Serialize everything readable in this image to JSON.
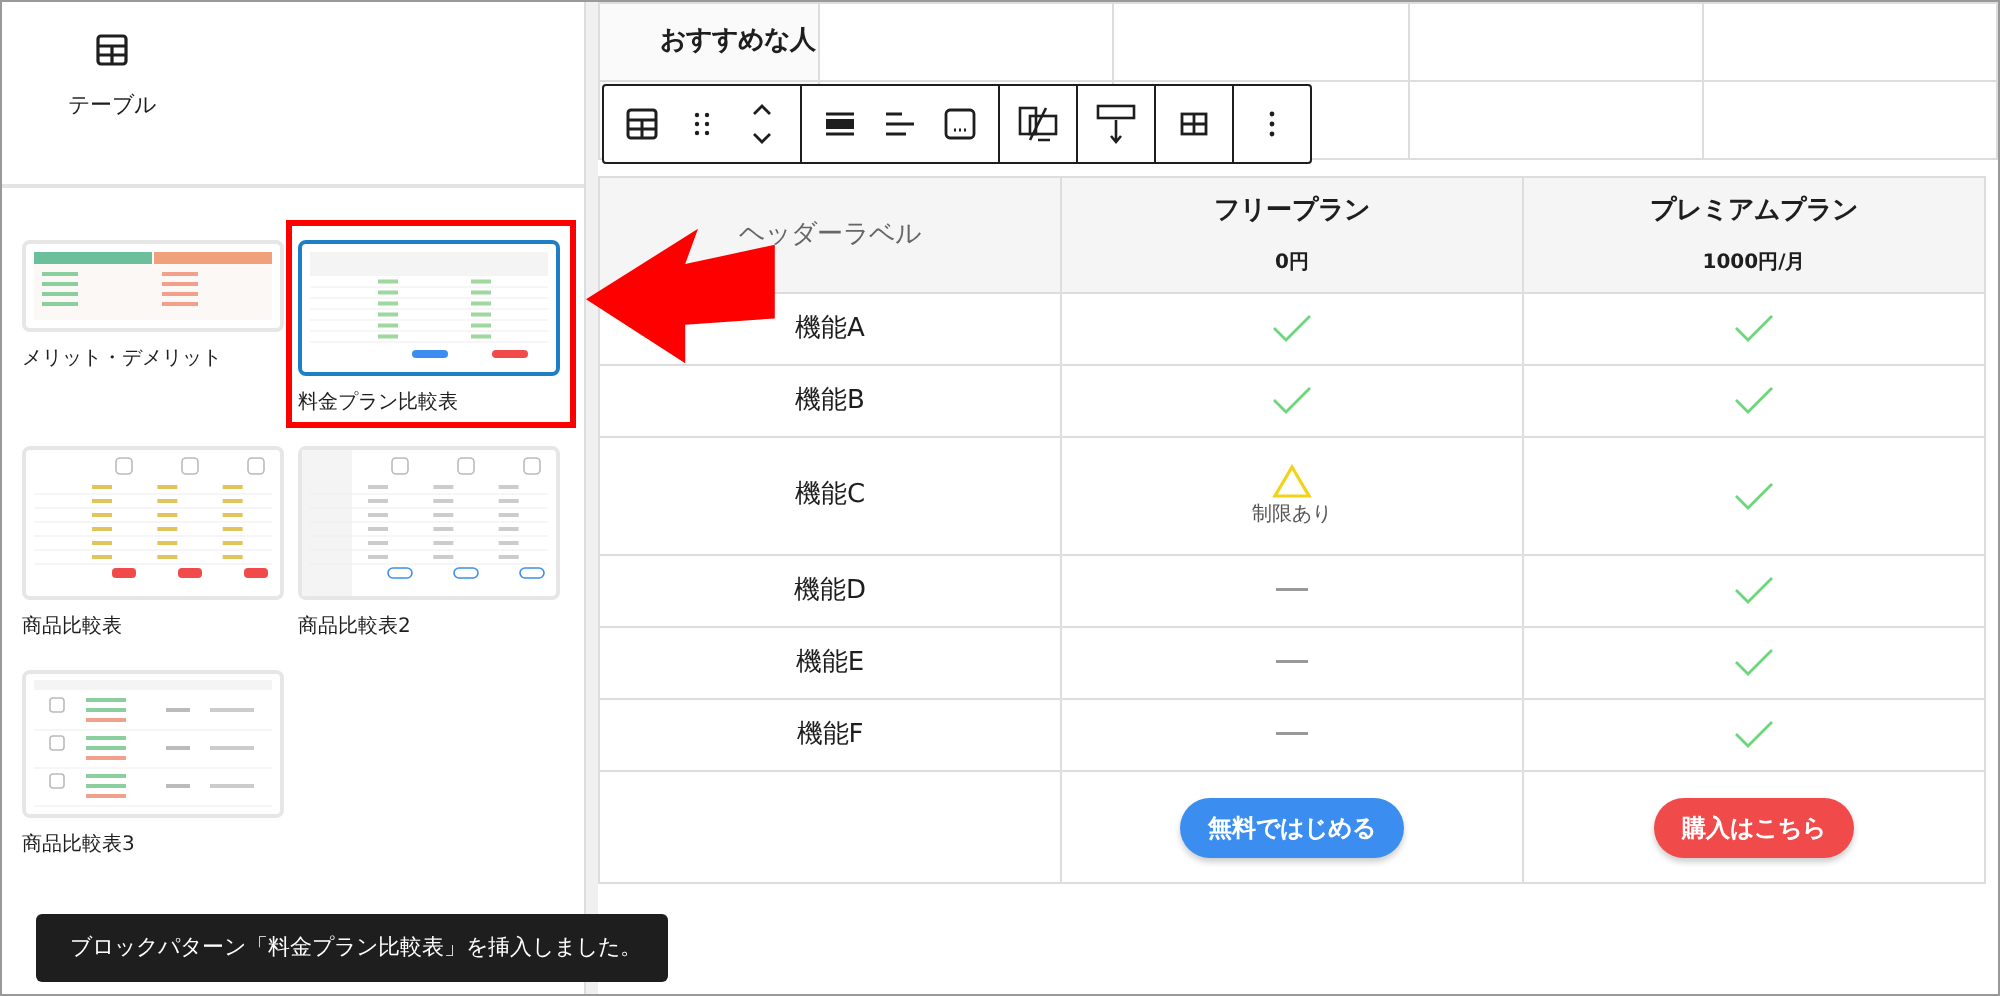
{
  "sidebar": {
    "block": {
      "label": "テーブル"
    },
    "patterns": [
      {
        "label": "メリット・デメリット",
        "kind": "merit",
        "selected": false
      },
      {
        "label": "料金プラン比較表",
        "kind": "plan",
        "selected": true
      },
      {
        "label": "商品比較表",
        "kind": "product",
        "selected": false
      },
      {
        "label": "商品比較表2",
        "kind": "product2",
        "selected": false
      },
      {
        "label": "商品比較表3",
        "kind": "product3",
        "selected": false
      }
    ]
  },
  "top_table": {
    "rows": [
      {
        "label": "おすすめな人"
      }
    ]
  },
  "table": {
    "header_label": "ヘッダーラベル",
    "plans": [
      {
        "name": "フリープラン",
        "price": "0円",
        "button": "無料ではじめる",
        "color": "#3b8ef0"
      },
      {
        "name": "プレミアムプラン",
        "price": "1000円/月",
        "button": "購入はこちら",
        "color": "#f04a4a"
      }
    ],
    "rows": [
      {
        "feature": "機能A",
        "cells": [
          {
            "kind": "check"
          },
          {
            "kind": "check"
          }
        ]
      },
      {
        "feature": "機能B",
        "cells": [
          {
            "kind": "check"
          },
          {
            "kind": "check"
          }
        ]
      },
      {
        "feature": "機能C",
        "cells": [
          {
            "kind": "limited",
            "note": "制限あり"
          },
          {
            "kind": "check"
          }
        ]
      },
      {
        "feature": "機能D",
        "cells": [
          {
            "kind": "none"
          },
          {
            "kind": "check"
          }
        ]
      },
      {
        "feature": "機能E",
        "cells": [
          {
            "kind": "none"
          },
          {
            "kind": "check"
          }
        ]
      },
      {
        "feature": "機能F",
        "cells": [
          {
            "kind": "none"
          },
          {
            "kind": "check"
          }
        ]
      }
    ]
  },
  "snackbar": {
    "message": "ブロックパターン「料金プラン比較表」を挿入しました。"
  }
}
